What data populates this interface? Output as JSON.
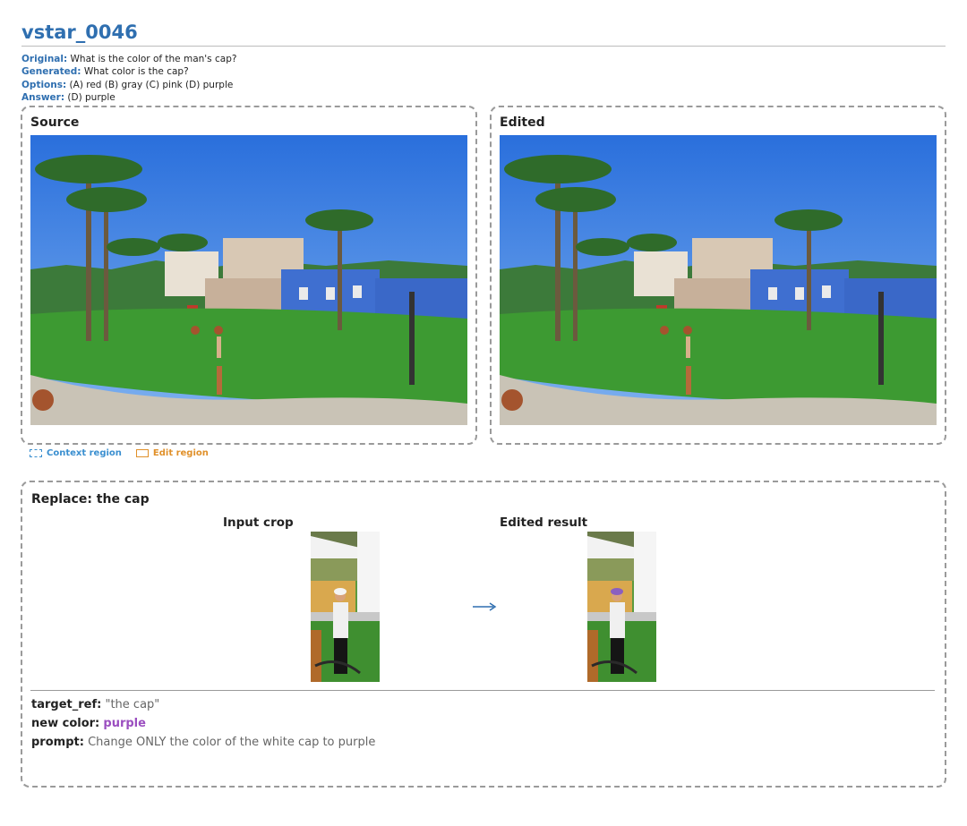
{
  "title": "vstar_0046",
  "meta": {
    "original_label": "Original:",
    "original_value": "What is the color of the man's cap?",
    "generated_label": "Generated:",
    "generated_value": "What color is the cap?",
    "options_label": "Options:",
    "options_value": "(A) red (B) gray (C) pink (D) purple",
    "answer_label": "Answer:",
    "answer_value": "(D) purple"
  },
  "panels": {
    "source_title": "Source",
    "edited_title": "Edited"
  },
  "legend": {
    "context": "Context region",
    "edit": "Edit region"
  },
  "replace": {
    "title": "Replace: the cap",
    "input_label": "Input crop",
    "result_label": "Edited result"
  },
  "fields": {
    "target_ref_label": "target_ref:",
    "target_ref_value": "\"the cap\"",
    "new_color_label": "new color:",
    "new_color_value": "purple",
    "prompt_label": "prompt:",
    "prompt_value": "Change ONLY the color of the white cap to purple"
  },
  "colors": {
    "accent_blue": "#2f6fb0",
    "context_blue": "#3a8fd0",
    "edit_orange": "#e0902a",
    "purple": "#9b4fc0",
    "cap_original": "#f4f4f4",
    "cap_edited": "#8b5fc0"
  }
}
